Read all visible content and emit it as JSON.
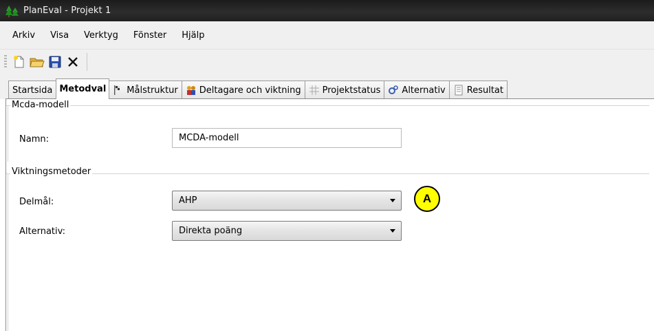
{
  "window": {
    "title": "PlanEval - Projekt 1",
    "app_icon": "pine-trees-icon"
  },
  "menu": [
    "Arkiv",
    "Visa",
    "Verktyg",
    "Fönster",
    "Hjälp"
  ],
  "toolbar": {
    "icons": [
      "new-document-icon",
      "open-folder-icon",
      "save-disk-icon",
      "delete-x-icon"
    ]
  },
  "tabs": [
    {
      "label": "Startsida",
      "icon": "",
      "active": false
    },
    {
      "label": "Metodval",
      "icon": "",
      "active": true
    },
    {
      "label": "Målstruktur",
      "icon": "flag-icon",
      "active": false
    },
    {
      "label": "Deltagare och viktning",
      "icon": "people-icon",
      "active": false
    },
    {
      "label": "Projektstatus",
      "icon": "grid-icon",
      "active": false
    },
    {
      "label": "Alternativ",
      "icon": "gears-icon",
      "active": false
    },
    {
      "label": "Resultat",
      "icon": "document-icon",
      "active": false
    }
  ],
  "model_group": {
    "legend": "Mcda-modell",
    "name_label": "Namn:",
    "name_value": "MCDA-modell"
  },
  "weighting_group": {
    "legend": "Viktningsmetoder",
    "delmal_label": "Delmål:",
    "delmal_value": "AHP",
    "alternativ_label": "Alternativ:",
    "alternativ_value": "Direkta poäng"
  },
  "callout": {
    "label": "A",
    "color": "#ffff00"
  }
}
